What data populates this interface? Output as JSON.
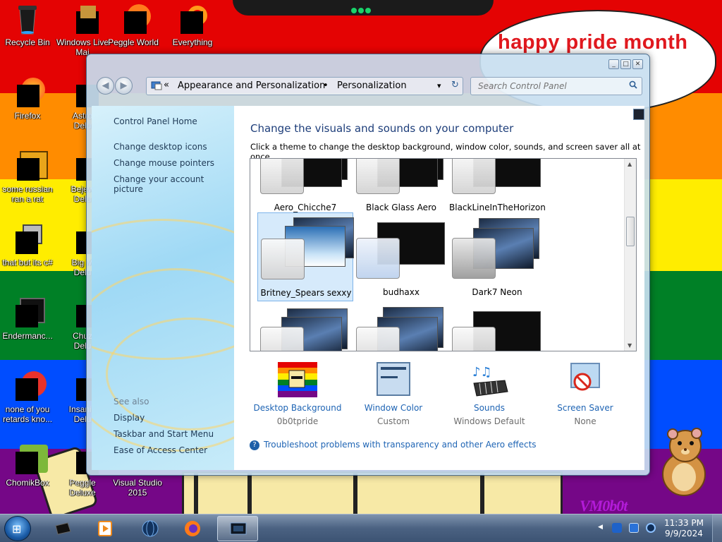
{
  "wallpaper": {
    "banner_text": "happy pride month",
    "signature": "VM0b0t",
    "colors": [
      "#e40303",
      "#ff8c00",
      "#ffed00",
      "#008026",
      "#004dff",
      "#750787"
    ]
  },
  "desktop_icons": [
    {
      "label": "Recycle Bin",
      "icon": "recycle-bin-icon"
    },
    {
      "label": "Windows Live\nMai",
      "icon": "windows-live-mail-icon"
    },
    {
      "label": "Peggle World",
      "icon": "peggle-world-icon"
    },
    {
      "label": "Everything",
      "icon": "everything-icon"
    },
    {
      "label": "Firefox",
      "icon": "firefox-icon"
    },
    {
      "label": "Astro\nDelu",
      "icon": "astro-deluxe-icon"
    },
    {
      "label": "some russian\nran a rat",
      "icon": "russian-rat-icon"
    },
    {
      "label": "Bejew\nDelu",
      "icon": "bejeweled-deluxe-icon"
    },
    {
      "label": "that but its c#",
      "icon": "that-but-csharp-icon"
    },
    {
      "label": "Big M\nDelu",
      "icon": "big-money-deluxe-icon"
    },
    {
      "label": "Endermanc...",
      "icon": "endermanch-icon"
    },
    {
      "label": "Chuz\nDelu",
      "icon": "chuzzle-deluxe-icon"
    },
    {
      "label": "none of you\nretards kno...",
      "icon": "none-of-you-icon"
    },
    {
      "label": "Insaniq\nDelu",
      "icon": "insaniquarium-deluxe-icon"
    },
    {
      "label": "ChomikBox",
      "icon": "chomikbox-icon"
    },
    {
      "label": "Peggle Deluxe",
      "icon": "peggle-deluxe-icon"
    },
    {
      "label": "Visual Studio\n2015",
      "icon": "visual-studio-icon"
    }
  ],
  "window": {
    "caption_buttons": {
      "minimize": "_",
      "maximize": "□",
      "close": "✕"
    },
    "nav": {
      "back": "◀",
      "forward": "▶",
      "dropdown": "▾",
      "refresh": "↻"
    },
    "breadcrumb": {
      "chevron": "«",
      "items": [
        "Appearance and Personalization",
        "Personalization"
      ],
      "separator": "•"
    },
    "search": {
      "placeholder": "Search Control Panel"
    },
    "left_pane": {
      "home_link": "Control Panel Home",
      "links": [
        "Change desktop icons",
        "Change mouse pointers",
        "Change your account picture"
      ],
      "see_also_label": "See also",
      "see_also_links": [
        "Display",
        "Taskbar and Start Menu",
        "Ease of Access Center"
      ]
    },
    "main": {
      "heading": "Change the visuals and sounds on your computer",
      "subtext": "Click a theme to change the desktop background, window color, sounds, and screen saver all at once.",
      "themes": [
        {
          "name": "Aero_Chicche7",
          "selected": false
        },
        {
          "name": "Black Glass Aero",
          "selected": false
        },
        {
          "name": "BlackLineInTheHorizon",
          "selected": false
        },
        {
          "name": "Britney_Spears sexxy",
          "selected": true
        },
        {
          "name": "budhaxx",
          "selected": false
        },
        {
          "name": "Dark7 Neon",
          "selected": false
        },
        {
          "name": "",
          "selected": false
        },
        {
          "name": "",
          "selected": false
        },
        {
          "name": "",
          "selected": false
        }
      ],
      "settings": [
        {
          "title": "Desktop Background",
          "value": "0b0tpride",
          "icon": "desktop-background-icon"
        },
        {
          "title": "Window Color",
          "value": "Custom",
          "icon": "window-color-icon"
        },
        {
          "title": "Sounds",
          "value": "Windows Default",
          "icon": "sounds-icon"
        },
        {
          "title": "Screen Saver",
          "value": "None",
          "icon": "screen-saver-icon"
        }
      ],
      "troubleshoot_link": "Troubleshoot problems with transparency and other Aero effects"
    }
  },
  "taskbar": {
    "start_label": "⊞",
    "buttons": [
      {
        "icon": "computer-icon",
        "active": false
      },
      {
        "icon": "media-player-icon",
        "active": false
      },
      {
        "icon": "globe-icon",
        "active": false
      },
      {
        "icon": "firefox-icon",
        "active": false
      },
      {
        "icon": "control-panel-icon",
        "active": true
      }
    ],
    "clock": {
      "time": "11:33 PM",
      "date": "9/9/2024"
    }
  }
}
